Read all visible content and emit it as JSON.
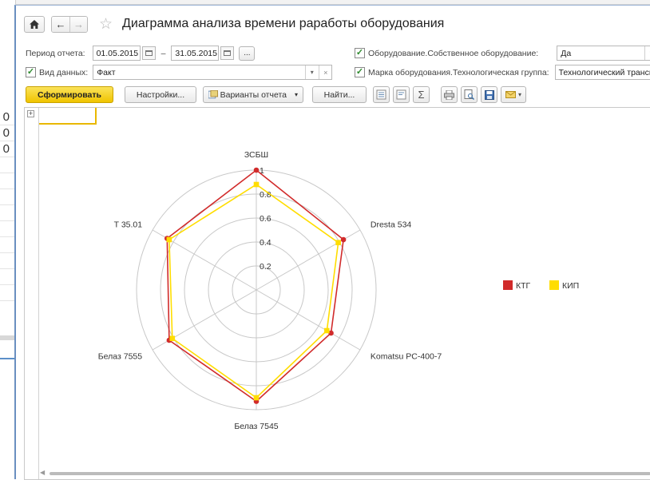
{
  "background": {
    "numbers": [
      "0",
      "0",
      "0"
    ]
  },
  "header": {
    "title": "Диаграмма анализа времени раработы оборудования"
  },
  "filters": {
    "period_label": "Период отчета:",
    "date_from": "01.05.2015",
    "dash": "–",
    "date_to": "31.05.2015",
    "ellipsis": "...",
    "own_equipment_label": "Оборудование.Собственное оборудование:",
    "own_equipment_value": "Да",
    "data_type_label": "Вид данных:",
    "data_type_value": "Факт",
    "group_label": "Марка оборудования.Технологическая группа:",
    "group_value": "Технологический транспорт;"
  },
  "toolbar": {
    "generate": "Сформировать",
    "settings": "Настройки...",
    "variants": "Варианты отчета",
    "find": "Найти...",
    "sum_icon": "Σ"
  },
  "chart_data": {
    "type": "radar",
    "categories": [
      "ЗСБШ",
      "Dresta 534",
      "Komatsu PC-400-7",
      "Белаз 7545",
      "Белаз 7555",
      "T 35.01"
    ],
    "series": [
      {
        "name": "КТГ",
        "color": "#d12b2b",
        "values": [
          1.0,
          0.84,
          0.72,
          0.93,
          0.84,
          0.86
        ]
      },
      {
        "name": "КИП",
        "color": "#ffdd00",
        "values": [
          0.88,
          0.79,
          0.68,
          0.9,
          0.81,
          0.84
        ]
      }
    ],
    "rlim": [
      0,
      1
    ],
    "tick_labels": [
      "0.2",
      "0.4",
      "0.6",
      "0.8",
      "1"
    ],
    "legend_position": "right"
  }
}
